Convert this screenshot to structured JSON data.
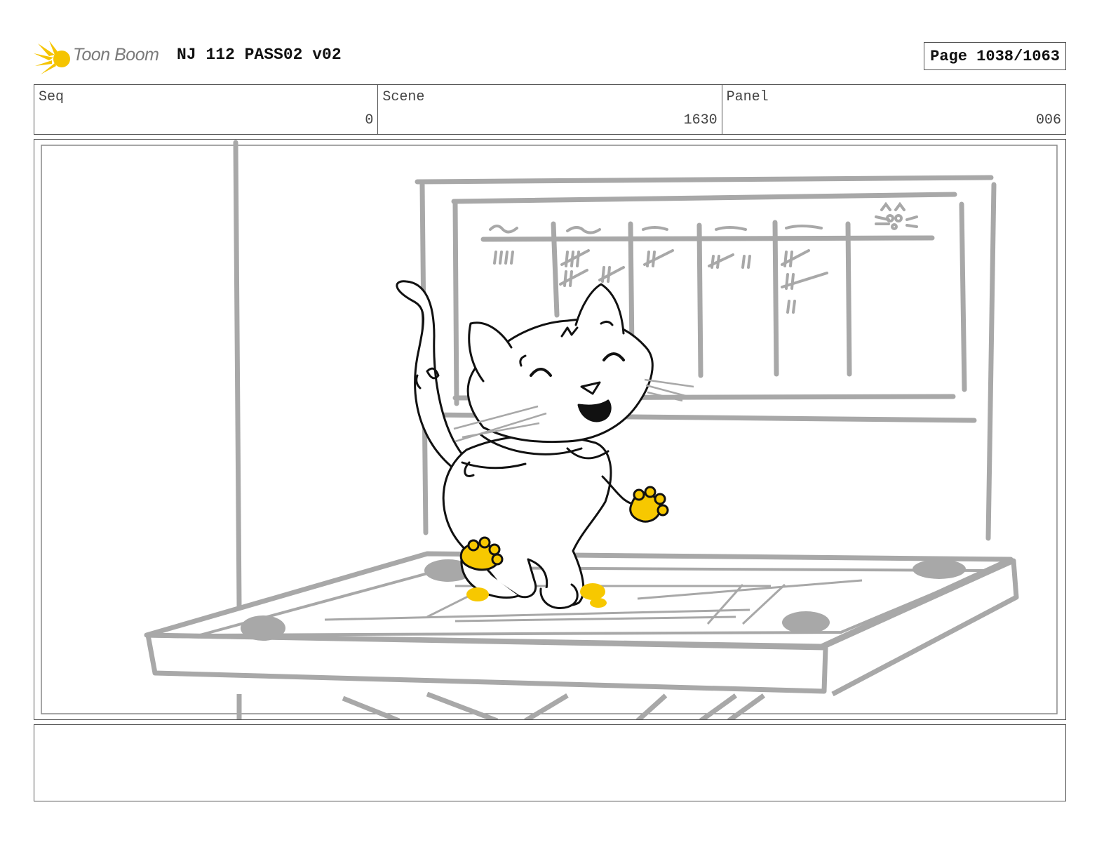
{
  "header": {
    "logo_text": "Toon Boom",
    "project_title": "NJ 112 PASS02 v02",
    "page_label": "Page 1038/1063"
  },
  "info": {
    "seq_label": "Seq",
    "seq_value": "0",
    "scene_label": "Scene",
    "scene_value": "1630",
    "panel_label": "Panel",
    "panel_value": "006"
  },
  "colors": {
    "logo_yellow": "#f5c400",
    "paw_yellow": "#f7c800",
    "sketch_gray": "#a8a8a8",
    "line_black": "#111111"
  },
  "panel": {
    "description_icon": "storyboard-sketch-cat-on-table"
  },
  "notes": {
    "text": ""
  }
}
